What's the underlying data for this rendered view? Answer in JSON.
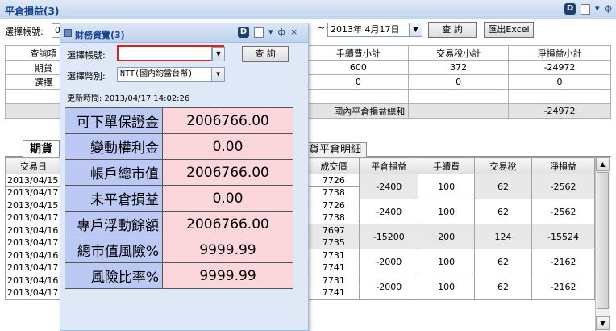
{
  "window": {
    "title": "平倉損益(3)"
  },
  "toolbar": {
    "account_label": "選擇帳號:",
    "account_value": "0",
    "tilde": "~",
    "date_end": "2013年  4月17日",
    "query_label": "查 詢",
    "export_label": "匯出Excel"
  },
  "summary": {
    "headers": [
      "查詢項",
      "",
      "手續費小計",
      "交易稅小計",
      "淨損益小計"
    ],
    "rows": [
      [
        "期貨",
        "",
        "600",
        "372",
        "-24972"
      ],
      [
        "選擇",
        "",
        "0",
        "0",
        "0"
      ],
      [
        "",
        "",
        "",
        "",
        ""
      ]
    ],
    "total_label": "國內平倉損益總和",
    "total_value": "-24972"
  },
  "tabs": {
    "active": "期貨",
    "other": "貨平倉明細"
  },
  "grid": {
    "headers": [
      "交易日",
      "",
      "成交價",
      "平倉損益",
      "手續費",
      "交易稅",
      "淨損益"
    ],
    "groups": [
      {
        "dates": [
          "2013/04/15",
          "2013/04/17"
        ],
        "prices": [
          "7726",
          "7738"
        ],
        "pnl": "-2400",
        "fee": "100",
        "tax": "62",
        "net": "-2562"
      },
      {
        "dates": [
          "2013/04/15",
          "2013/04/17"
        ],
        "prices": [
          "7726",
          "7738"
        ],
        "pnl": "-2400",
        "fee": "100",
        "tax": "62",
        "net": "-2562"
      },
      {
        "dates": [
          "2013/04/16",
          "2013/04/17"
        ],
        "prices": [
          "7697",
          "7735"
        ],
        "pnl": "-15200",
        "fee": "200",
        "tax": "124",
        "net": "-15524"
      },
      {
        "dates": [
          "2013/04/16",
          "2013/04/17"
        ],
        "prices": [
          "7731",
          "7741"
        ],
        "pnl": "-2000",
        "fee": "100",
        "tax": "62",
        "net": "-2162"
      },
      {
        "dates": [
          "2013/04/16",
          "2013/04/17"
        ],
        "prices": [
          "7731",
          "7741"
        ],
        "pnl": "-2000",
        "fee": "100",
        "tax": "62",
        "net": "-2162"
      }
    ]
  },
  "popup": {
    "title": "財務資覽(3)",
    "account_label": "選擇帳號:",
    "account_value": "",
    "query_label": "查 詢",
    "currency_label": "選擇幣別:",
    "currency_value": "NTT(國內約當台幣)",
    "updated": "更新時間: 2013/04/17 14:02:26",
    "stats": [
      {
        "label": "可下單保證金",
        "value": "2006766.00"
      },
      {
        "label": "變動權利金",
        "value": "0.00"
      },
      {
        "label": "帳戶總市值",
        "value": "2006766.00"
      },
      {
        "label": "未平倉損益",
        "value": "0.00"
      },
      {
        "label": "專戶浮動餘額",
        "value": "2006766.00"
      },
      {
        "label": "總市值風險%",
        "value": "9999.99"
      },
      {
        "label": "風險比率%",
        "value": "9999.99"
      }
    ]
  },
  "icons": {
    "dock": "D",
    "pin": "ф",
    "close": "×",
    "dropdown": "▼"
  }
}
